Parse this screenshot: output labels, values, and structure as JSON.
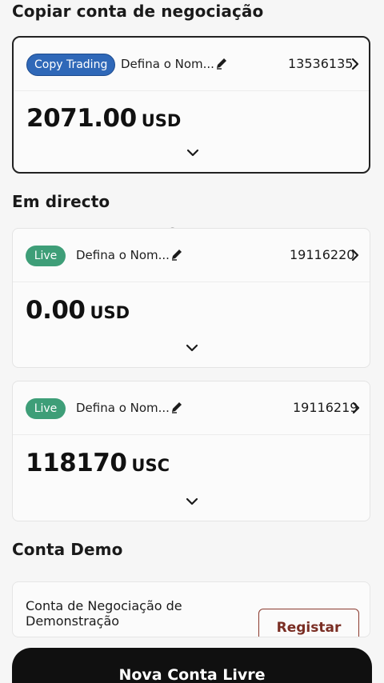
{
  "copy_section": {
    "title": "Copiar conta de negociação",
    "account": {
      "badge": "Copy Trading",
      "name": "Defina o Nom...",
      "number": "13536135",
      "balance": "2071.00",
      "currency": "USD"
    }
  },
  "live_section": {
    "title": "Em directo",
    "accounts": [
      {
        "badge": "Live",
        "name": "Defina o Nom...",
        "number": "19116220",
        "balance": "0.00",
        "currency": "USD"
      },
      {
        "badge": "Live",
        "name": "Defina o Nom...",
        "number": "19116219",
        "balance": "118170",
        "currency": "USC"
      }
    ]
  },
  "demo_section": {
    "title": "Conta Demo",
    "card_text": "Conta de Negociação de Demonstração",
    "register_label": "Registar"
  },
  "new_account_button": "Nova Conta Livre",
  "icons": {
    "edit": "pencil-icon",
    "open": "chevron-right-icon",
    "expand": "chevron-down-icon"
  },
  "colors": {
    "copy_badge": "#2f68b8",
    "live_badge": "#3e9e78",
    "register_accent": "#8a3a2e",
    "primary_button": "#101010"
  }
}
